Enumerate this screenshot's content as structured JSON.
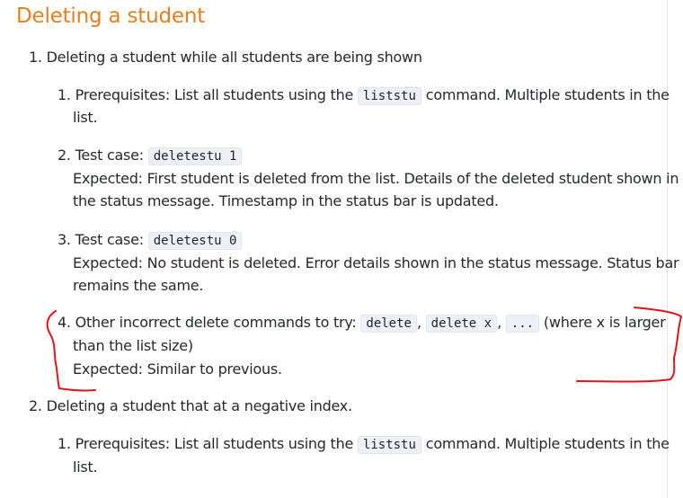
{
  "section": {
    "title": "Deleting a student"
  },
  "list": [
    {
      "number": "1.",
      "text": "Deleting a student while all students are being shown",
      "steps": [
        {
          "number": "1.",
          "prefix": "Prerequisites: List all students using the",
          "code": "liststu",
          "suffix": "command. Multiple students in the",
          "line2": "list."
        },
        {
          "number": "2.",
          "prefix": "Test case:",
          "code": "deletestu 1",
          "line2": "Expected: First student is deleted from the list. Details of the deleted student shown in",
          "line3": "the status message. Timestamp in the status bar is updated."
        },
        {
          "number": "3.",
          "prefix": "Test case:",
          "code": "deletestu 0",
          "line2": "Expected: No student is deleted. Error details shown in the status message. Status bar",
          "line3": "remains the same."
        },
        {
          "number": "4.",
          "prefix": "Other incorrect delete commands to try:",
          "codes": [
            "delete",
            "delete x",
            "..."
          ],
          "sep": ",",
          "suffix": "(where x is larger",
          "line2": "than the list size)",
          "line3": "Expected: Similar to previous."
        }
      ]
    },
    {
      "number": "2.",
      "text": "Deleting a student that at a negative index.",
      "steps": [
        {
          "number": "1.",
          "prefix": "Prerequisites: List all students using the",
          "code": "liststu",
          "suffix": "command. Multiple students in the",
          "line2": "list."
        }
      ]
    }
  ],
  "annotation": {
    "color": "#e0141b",
    "shape": "red-bracket-marks"
  }
}
